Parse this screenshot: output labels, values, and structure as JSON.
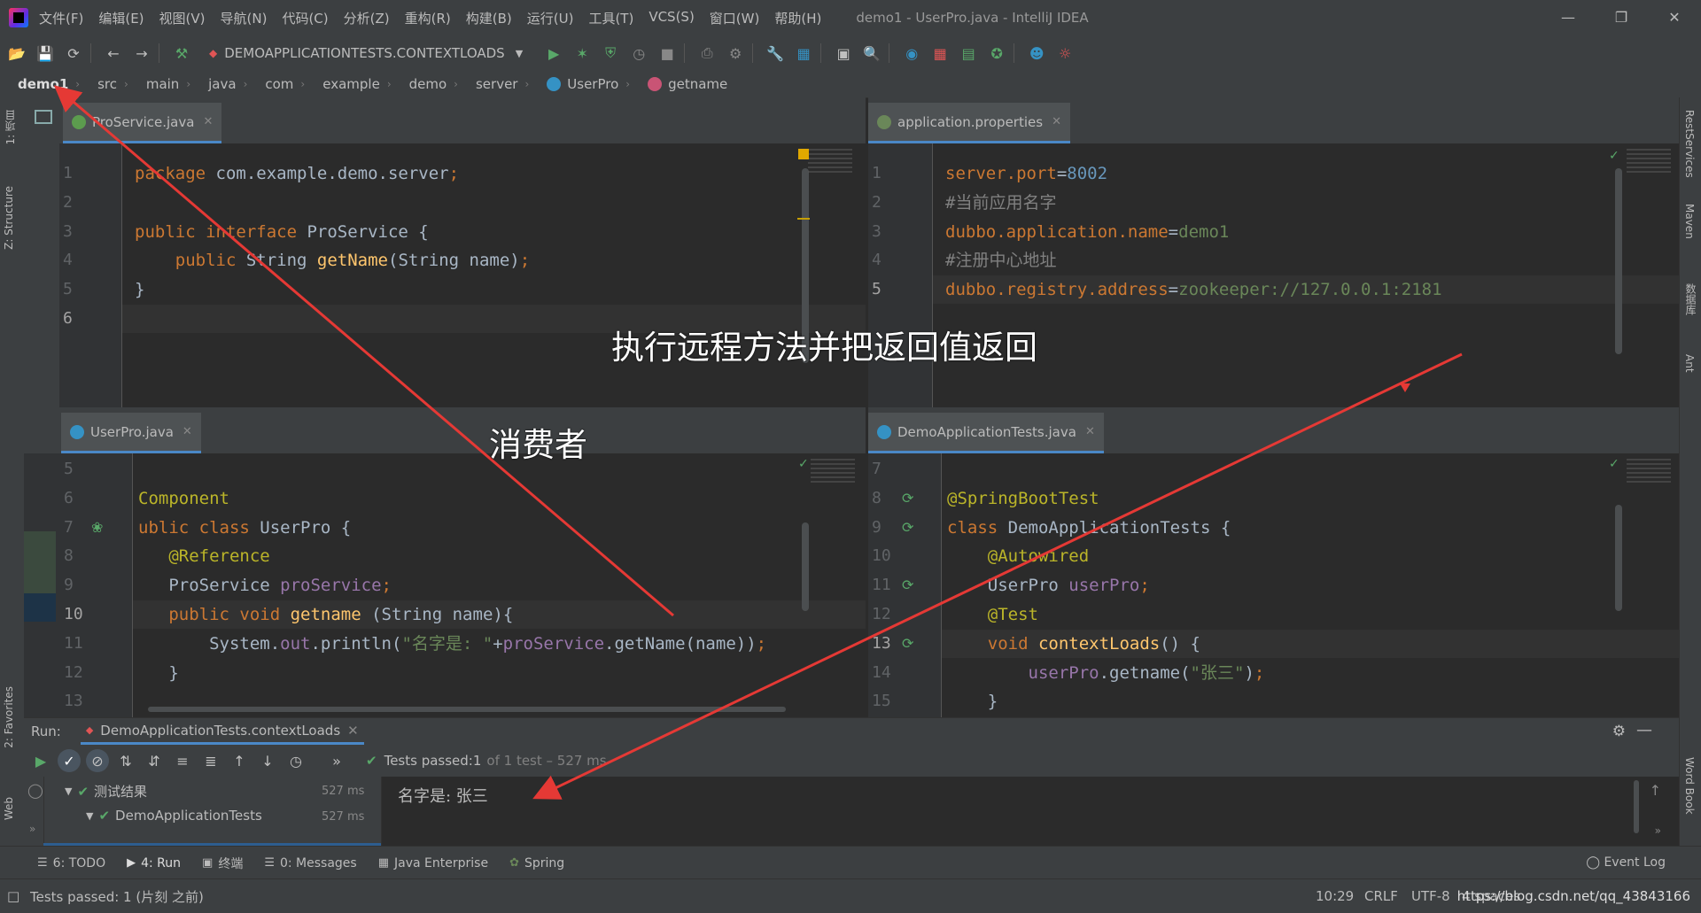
{
  "menu": [
    "文件(F)",
    "编辑(E)",
    "视图(V)",
    "导航(N)",
    "代码(C)",
    "分析(Z)",
    "重构(R)",
    "构建(B)",
    "运行(U)",
    "工具(T)",
    "VCS(S)",
    "窗口(W)",
    "帮助(H)"
  ],
  "window_title": "demo1 - UserPro.java - IntelliJ IDEA",
  "toolbar": {
    "run_config": "DEMOAPPLICATIONTESTS.CONTEXTLOADS"
  },
  "breadcrumb": [
    "demo1",
    "src",
    "main",
    "java",
    "com",
    "example",
    "demo",
    "server",
    "UserPro",
    "getname"
  ],
  "left_tools": [
    "1: 项目",
    "Z: Structure",
    "2: Favorites",
    "Web"
  ],
  "right_tools": [
    "RestServices",
    "Maven",
    "数据库",
    "Ant",
    "Word Book"
  ],
  "editors": {
    "proservice": {
      "tab": "ProService.java",
      "line_numbers": [
        "1",
        "2",
        "3",
        "4",
        "5",
        "6"
      ],
      "lines": [
        [
          {
            "t": "package ",
            "c": "kw"
          },
          {
            "t": "com.example.demo.server",
            "c": "id"
          },
          {
            "t": ";",
            "c": "kw"
          }
        ],
        [],
        [
          {
            "t": "public interface ",
            "c": "kw"
          },
          {
            "t": "ProService {",
            "c": "id"
          }
        ],
        [
          {
            "t": "    public ",
            "c": "kw"
          },
          {
            "t": "String ",
            "c": "id"
          },
          {
            "t": "getName",
            "c": "fn"
          },
          {
            "t": "(String name)",
            "c": "id"
          },
          {
            "t": ";",
            "c": "kw"
          }
        ],
        [
          {
            "t": "}",
            "c": "id"
          }
        ],
        []
      ]
    },
    "props": {
      "tab": "application.properties",
      "line_numbers": [
        "1",
        "2",
        "3",
        "4",
        "5"
      ],
      "lines": [
        [
          {
            "t": "server.port",
            "c": "prop"
          },
          {
            "t": "=",
            "c": "id"
          },
          {
            "t": "8002",
            "c": "num"
          }
        ],
        [
          {
            "t": "#当前应用名字",
            "c": "cmt"
          }
        ],
        [
          {
            "t": "dubbo.application.name",
            "c": "prop"
          },
          {
            "t": "=",
            "c": "id"
          },
          {
            "t": "demo1",
            "c": "pval"
          }
        ],
        [
          {
            "t": "#注册中心地址",
            "c": "cmt"
          }
        ],
        [
          {
            "t": "dubbo.registry.address",
            "c": "prop"
          },
          {
            "t": "=",
            "c": "id"
          },
          {
            "t": "zookeeper://127.0.0.1:2181",
            "c": "pval"
          }
        ]
      ]
    },
    "userpro": {
      "tab": "UserPro.java",
      "line_numbers": [
        "5",
        "6",
        "7",
        "8",
        "9",
        "10",
        "11",
        "12",
        "13"
      ],
      "lines": [
        [],
        [
          {
            "t": "Component",
            "c": "an"
          }
        ],
        [
          {
            "t": "ublic class ",
            "c": "kw"
          },
          {
            "t": "UserPro {",
            "c": "id"
          }
        ],
        [
          {
            "t": "   @Reference",
            "c": "an"
          }
        ],
        [
          {
            "t": "   ProService ",
            "c": "id"
          },
          {
            "t": "proService",
            "c": "fld"
          },
          {
            "t": ";",
            "c": "kw"
          }
        ],
        [
          {
            "t": "   public void ",
            "c": "kw"
          },
          {
            "t": "getname ",
            "c": "fn"
          },
          {
            "t": "(String name){",
            "c": "id"
          }
        ],
        [
          {
            "t": "       System.",
            "c": "id"
          },
          {
            "t": "out",
            "c": "fld"
          },
          {
            "t": ".println(",
            "c": "id"
          },
          {
            "t": "\"名字是: \"",
            "c": "str"
          },
          {
            "t": "+",
            "c": "id"
          },
          {
            "t": "proService",
            "c": "fld"
          },
          {
            "t": ".getName(name))",
            "c": "id"
          },
          {
            "t": ";",
            "c": "kw"
          }
        ],
        [
          {
            "t": "   }",
            "c": "id"
          }
        ],
        []
      ]
    },
    "tests": {
      "tab": "DemoApplicationTests.java",
      "line_numbers": [
        "7",
        "8",
        "9",
        "10",
        "11",
        "12",
        "13",
        "14",
        "15"
      ],
      "lines": [
        [],
        [
          {
            "t": "@SpringBootTest",
            "c": "an"
          }
        ],
        [
          {
            "t": "class ",
            "c": "kw"
          },
          {
            "t": "DemoApplicationTests {",
            "c": "id"
          }
        ],
        [
          {
            "t": "    @Autowired",
            "c": "an"
          }
        ],
        [
          {
            "t": "    UserPro ",
            "c": "id"
          },
          {
            "t": "userPro",
            "c": "fld"
          },
          {
            "t": ";",
            "c": "kw"
          }
        ],
        [
          {
            "t": "    @Test",
            "c": "an"
          }
        ],
        [
          {
            "t": "    void ",
            "c": "kw"
          },
          {
            "t": "contextLoads",
            "c": "fn"
          },
          {
            "t": "() {",
            "c": "id"
          }
        ],
        [
          {
            "t": "        userPro",
            "c": "fld"
          },
          {
            "t": ".getname(",
            "c": "id"
          },
          {
            "t": "\"张三\"",
            "c": "str"
          },
          {
            "t": ")",
            "c": "id"
          },
          {
            "t": ";",
            "c": "kw"
          }
        ],
        [
          {
            "t": "    }",
            "c": "id"
          }
        ]
      ]
    }
  },
  "run": {
    "label": "Run:",
    "tab": "DemoApplicationTests.contextLoads",
    "status_prefix": "Tests passed: ",
    "status_count": "1",
    "status_suffix": "of 1 test – 527 ms",
    "tree": [
      {
        "label": "测试结果",
        "ms": "527 ms"
      },
      {
        "label": "DemoApplicationTests",
        "ms": "527 ms"
      }
    ],
    "console_output": "名字是: 张三"
  },
  "bottom_tabs": [
    {
      "label": "6: TODO",
      "icon": "list-icon"
    },
    {
      "label": "4: Run",
      "icon": "play-icon"
    },
    {
      "label": "终端",
      "icon": "terminal-icon"
    },
    {
      "label": "0: Messages",
      "icon": "messages-icon"
    },
    {
      "label": "Java Enterprise",
      "icon": "javaee-icon"
    },
    {
      "label": "Spring",
      "icon": "spring-icon"
    }
  ],
  "event_log": "Event Log",
  "status": {
    "message": "Tests passed: 1 (片刻 之前)",
    "position": "10:29",
    "line_sep": "CRLF",
    "encoding": "UTF-8",
    "indent": "4 spaces",
    "watermark": "https://blog.csdn.net/qq_43843166"
  },
  "annotations": {
    "a1": "执行远程方法并把返回值返回",
    "a2": "消费者"
  },
  "colors": {
    "accent": "#4a88c7",
    "success": "#59a869",
    "arrow": "#e53935"
  }
}
